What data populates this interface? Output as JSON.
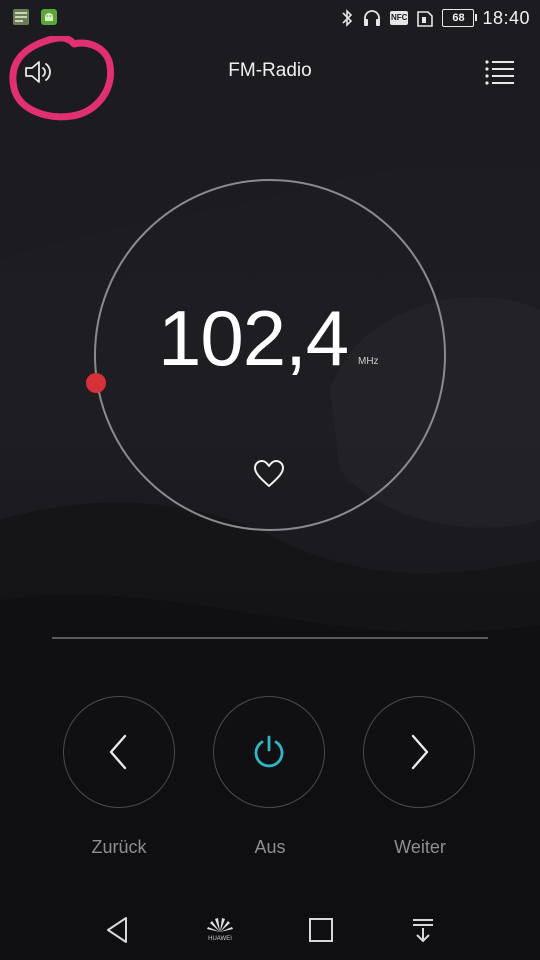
{
  "status_bar": {
    "time": "18:40",
    "battery_level": "68",
    "nfc_label": "NFC",
    "icons": [
      "notification-app-icon",
      "notification-android-icon",
      "bluetooth-icon",
      "headset-icon",
      "nfc-icon",
      "sim-icon",
      "battery-icon"
    ]
  },
  "header": {
    "title": "FM-Radio",
    "left_icon": "speaker-icon",
    "right_icon": "menu-list-icon"
  },
  "tuner": {
    "frequency": "102,4",
    "unit": "MHz",
    "favorite_icon": "heart-outline-icon",
    "tuner_dot_color": "#d6303b"
  },
  "controls": {
    "prev_label": "Zurück",
    "power_label": "Aus",
    "next_label": "Weiter",
    "power_color": "#2fb8c4"
  },
  "nav_bar": {
    "brand": "HUAWEI",
    "icons": [
      "back-triangle-icon",
      "huawei-logo",
      "recents-square-icon",
      "notification-pull-icon"
    ]
  },
  "colors": {
    "highlight_annotation": "#e0306f",
    "background": "#1c1c21",
    "text_muted": "#8e8e93"
  }
}
